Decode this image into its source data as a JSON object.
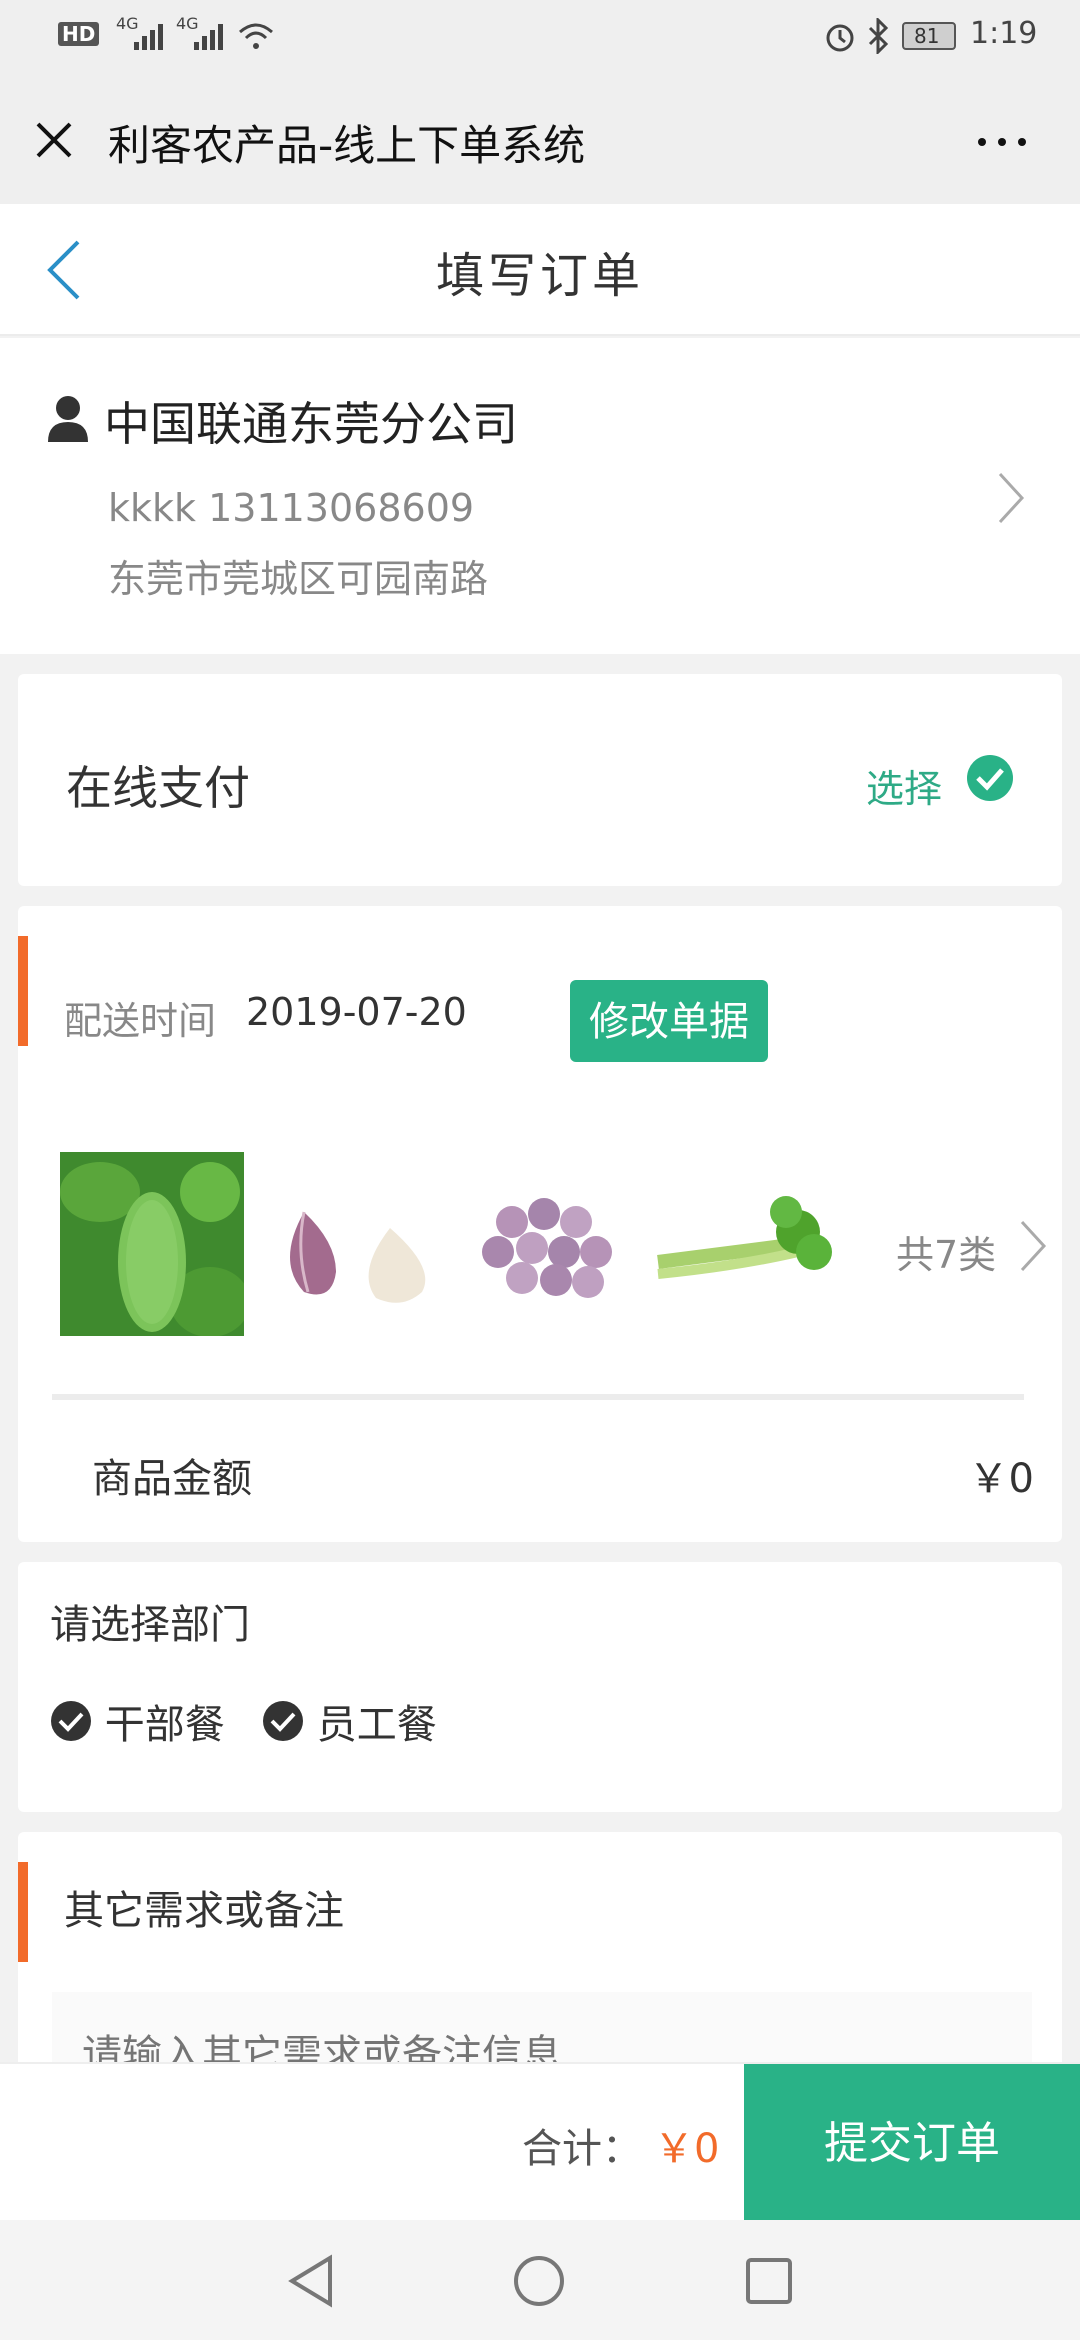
{
  "status_bar": {
    "left_hd": "HD",
    "left_net1": "4G",
    "left_net2": "4G",
    "battery": "81",
    "time": "1:19"
  },
  "wechat_header": {
    "title": "利客农产品-线上下单系统",
    "close_icon": "close-icon",
    "more_icon": "more-icon"
  },
  "page": {
    "title": "填写订单"
  },
  "address": {
    "company": "中国联通东莞分公司",
    "contact": "kkkk 13113068609",
    "street": "东莞市莞城区可园南路"
  },
  "payment": {
    "label": "在线支付",
    "choose_label": "选择"
  },
  "order": {
    "delivery_label": "配送时间",
    "delivery_date": "2019-07-20",
    "edit_button": "修改单据",
    "products": [
      {
        "icon": "loofah-image"
      },
      {
        "icon": "garlic-image"
      },
      {
        "icon": "purple-garlic-image"
      },
      {
        "icon": "celery-image"
      }
    ],
    "count_text": "共7类",
    "amount_label": "商品金额",
    "amount_value": "￥0"
  },
  "department": {
    "title": "请选择部门",
    "options": [
      "干部餐",
      "员工餐"
    ]
  },
  "notes": {
    "title": "其它需求或备注",
    "placeholder": "请输入其它需求或备注信息"
  },
  "footer": {
    "total_label": "合计：",
    "total_value": "￥0",
    "submit_label": "提交订单"
  },
  "colors": {
    "accent_green": "#29b287",
    "accent_orange": "#f26b2a"
  }
}
